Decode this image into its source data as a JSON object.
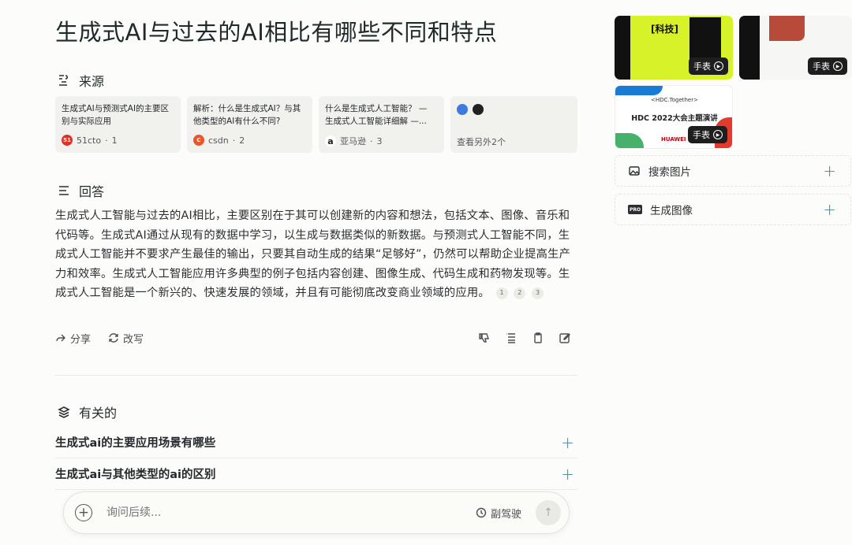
{
  "title": "生成式AI与过去的AI相比有哪些不同和特点",
  "sources_heading": "来源",
  "sources": [
    {
      "title": "生成式AI与预测式AI的主要区别与实际应用",
      "site": "51cto",
      "index": "1",
      "logo_text": "51",
      "logo_color": "#d9342b"
    },
    {
      "title": "解析：什么是生成式AI？与其他类型的AI有什么不同?",
      "site": "csdn",
      "index": "2",
      "logo_text": "C",
      "logo_color": "#e8562a"
    },
    {
      "title": "什么是生成式人工智能？ — 生成式人工智能详细解 —...",
      "site": "亚马逊",
      "index": "3",
      "logo_text": "a",
      "logo_color": "#222222"
    }
  ],
  "more_sources": "查看另外2个",
  "answer_heading": "回答",
  "answer": "生成式人工智能与过去的AI相比，主要区别在于其可以创建新的内容和想法，包括文本、图像、音乐和代码等。生成式AI通过从现有的数据中学习，以生成与数据类似的新数据。与预测式人工智能不同，生成式人工智能并不要求产生最佳的输出，只要其自动生成的结果“足够好”，仍然可以帮助企业提高生产力和效率。生成式人工智能应用许多典型的例子包括内容创建、图像生成、代码生成和药物发现等。生成式人工智能是一个新兴的、快速发展的领域，并且有可能彻底改变商业领域的应用。",
  "citations": [
    "1",
    "2",
    "3"
  ],
  "actions": {
    "share": "分享",
    "rewrite": "改写"
  },
  "related_heading": "有关的",
  "related": [
    "生成式ai的主要应用场景有哪些",
    "生成式ai与其他类型的ai的区别"
  ],
  "ask": {
    "placeholder": "询问后续...",
    "copilot": "副驾驶"
  },
  "videos": [
    {
      "badge": "手表",
      "caption": "[科技]"
    },
    {
      "badge": "手表",
      "caption": ""
    },
    {
      "badge": "手表",
      "caption": "HDC 2022大会主题演讲",
      "tag": "<HDC.Together>",
      "brand": "HUAWEI"
    }
  ],
  "side_actions": {
    "search_images": "搜索图片",
    "generate_image": "生成图像"
  },
  "colors": {
    "accent": "#3a8a95",
    "video_yellow": "#d8f22a"
  }
}
